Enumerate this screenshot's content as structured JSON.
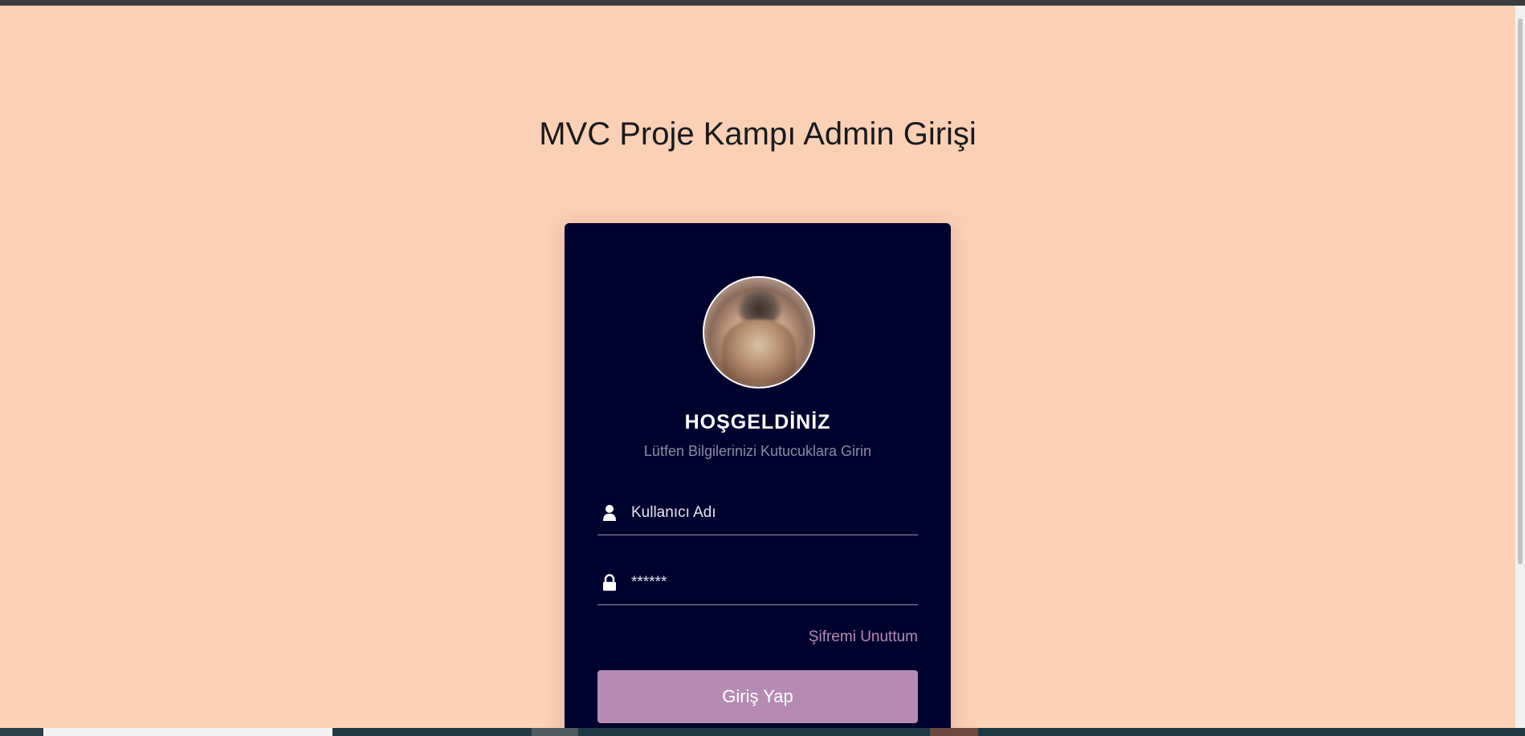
{
  "page": {
    "title": "MVC Proje Kampı Admin Girişi"
  },
  "card": {
    "welcome": "HOŞGELDİNİZ",
    "subtitle": "Lütfen Bilgilerinizi Kutucuklara Girin",
    "username": {
      "placeholder": "Kullanıcı Adı",
      "value": "",
      "icon": "user-icon"
    },
    "password": {
      "placeholder": "",
      "value": "******",
      "icon": "lock-icon"
    },
    "forgot_label": "Şifremi Unuttum",
    "login_label": "Giriş Yap"
  },
  "colors": {
    "background": "#fad0b7",
    "card": "#00022e",
    "accent": "#b58bb3",
    "link": "#b98bb6"
  }
}
